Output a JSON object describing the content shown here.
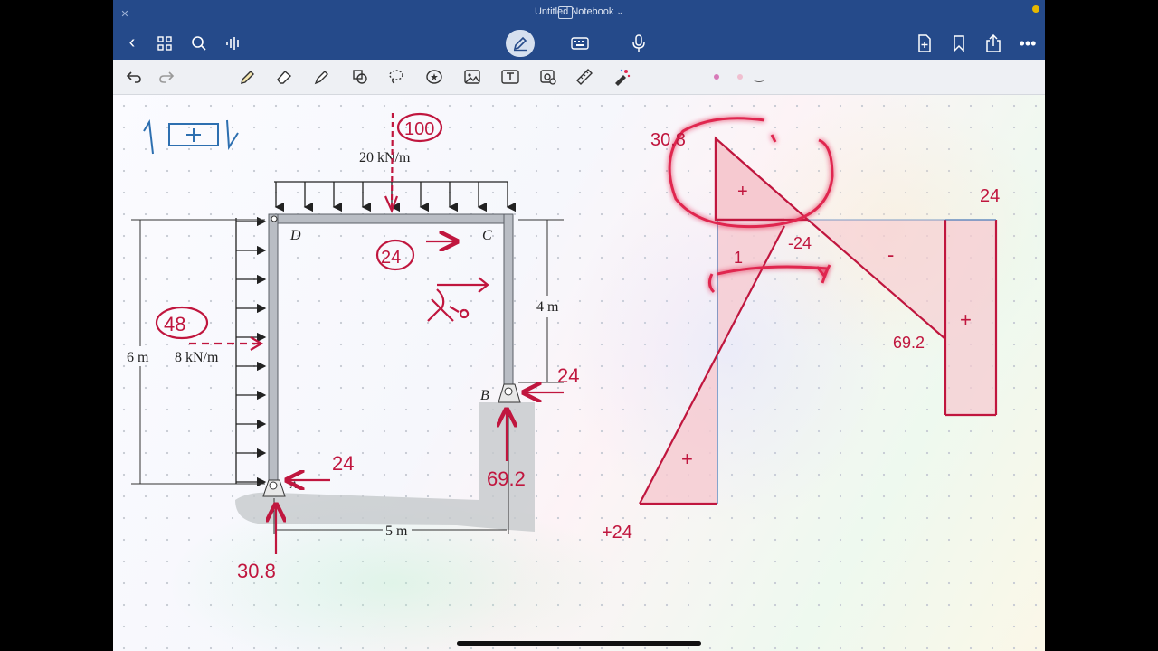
{
  "window": {
    "title": "Untitled Notebook"
  },
  "navbar": {
    "icons": [
      "back-icon",
      "grid-icon",
      "search-icon",
      "audio-wave-icon",
      "pen-mode-icon",
      "keyboard-icon",
      "microphone-icon",
      "add-page-icon",
      "bookmark-icon",
      "share-icon",
      "more-icon"
    ]
  },
  "toolbar": {
    "icons": [
      "undo-icon",
      "redo-icon",
      "pen-icon",
      "eraser-icon",
      "highlighter-icon",
      "shapes-icon",
      "lasso-icon",
      "sticker-icon",
      "image-icon",
      "textbox-icon",
      "camera-icon",
      "ruler-icon",
      "laser-pointer-icon"
    ]
  },
  "figure": {
    "dist_load_top": "20 kN/m",
    "dist_load_left": "8 kN/m",
    "dim_height": "6 m",
    "dim_right": "4 m",
    "dim_width": "5 m",
    "label_d": "D",
    "label_c": "C",
    "label_b": "B",
    "label_a": "A"
  },
  "annotations": {
    "top_resultant": "100",
    "left_resultant": "48",
    "member_force": "24",
    "reaction_b_horizontal": "24",
    "reaction_b_vertical": "69.2",
    "reaction_a_horizontal": "24",
    "reaction_a_vertical": "30.8",
    "diagram_left_top": "30.8",
    "diagram_left_bottom": "+24",
    "diagram_mid_label": "-24",
    "diagram_right_top": "24",
    "diagram_right_value": "69.2",
    "sign_plus": "+",
    "sign_minus": "-",
    "sign_one": "1"
  },
  "colors": {
    "ink": "#c0163e",
    "ink_blue": "#2d6fb0",
    "header": "#254a8a",
    "fill": "#f6c9d0"
  }
}
